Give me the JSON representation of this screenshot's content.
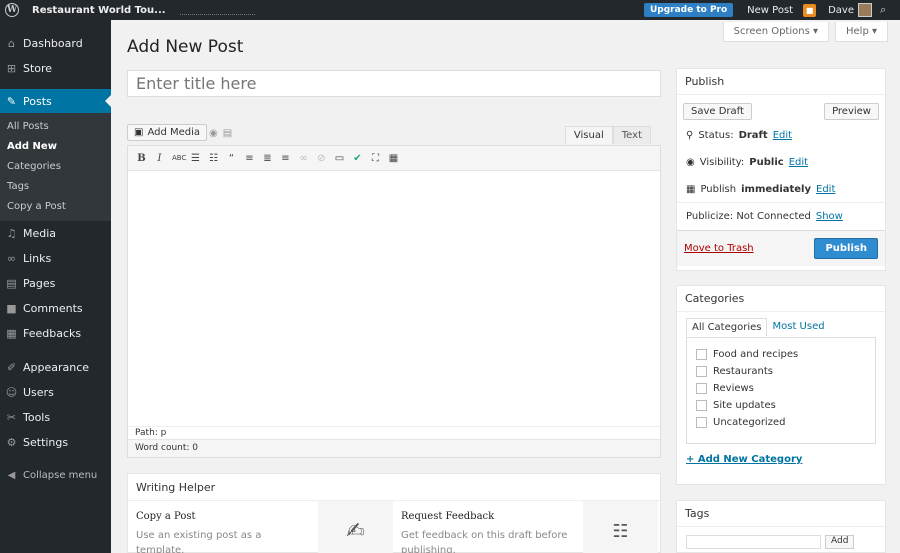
{
  "adminbar": {
    "site_name": "Restaurant World Tou...",
    "upgrade_label": "Upgrade to Pro",
    "new_post_label": "New Post",
    "user_name": "Dave"
  },
  "sidebar": {
    "items": [
      {
        "label": "Dashboard",
        "icon": "dashboard-icon"
      },
      {
        "label": "Store",
        "icon": "store-icon"
      },
      {
        "label": "Posts",
        "icon": "pin-icon"
      },
      {
        "label": "Media",
        "icon": "media-icon"
      },
      {
        "label": "Links",
        "icon": "link-icon"
      },
      {
        "label": "Pages",
        "icon": "pages-icon"
      },
      {
        "label": "Comments",
        "icon": "comments-icon"
      },
      {
        "label": "Feedbacks",
        "icon": "feedbacks-icon"
      },
      {
        "label": "Appearance",
        "icon": "brush-icon"
      },
      {
        "label": "Users",
        "icon": "users-icon"
      },
      {
        "label": "Tools",
        "icon": "tools-icon"
      },
      {
        "label": "Settings",
        "icon": "settings-icon"
      }
    ],
    "submenu": [
      "All Posts",
      "Add New",
      "Categories",
      "Tags",
      "Copy a Post"
    ],
    "collapse_label": "Collapse menu"
  },
  "header": {
    "screen_options": "Screen Options ▾",
    "help": "Help ▾",
    "page_title": "Add New Post"
  },
  "editor": {
    "title_placeholder": "Enter title here",
    "add_media": "Add Media",
    "tab_visual": "Visual",
    "tab_text": "Text",
    "path": "Path: p",
    "word_count": "Word count: 0"
  },
  "writing_helper": {
    "title": "Writing Helper",
    "copy_title": "Copy a Post",
    "copy_desc": "Use an existing post as a template.",
    "feedback_title": "Request Feedback",
    "feedback_desc": "Get feedback on this draft before publishing."
  },
  "publish": {
    "title": "Publish",
    "save_draft": "Save Draft",
    "preview": "Preview",
    "status_label": "Status:",
    "status_value": "Draft",
    "visibility_label": "Visibility:",
    "visibility_value": "Public",
    "publish_label": "Publish",
    "publish_value": "immediately",
    "edit": "Edit",
    "publicize_label": "Publicize: Not Connected",
    "publicize_link": "Show",
    "trash": "Move to Trash",
    "publish_button": "Publish"
  },
  "categories": {
    "title": "Categories",
    "tab_all": "All Categories",
    "tab_used": "Most Used",
    "items": [
      "Food and recipes",
      "Restaurants",
      "Reviews",
      "Site updates",
      "Uncategorized"
    ],
    "add_new": "+ Add New Category"
  },
  "tags": {
    "title": "Tags",
    "add": "Add"
  }
}
